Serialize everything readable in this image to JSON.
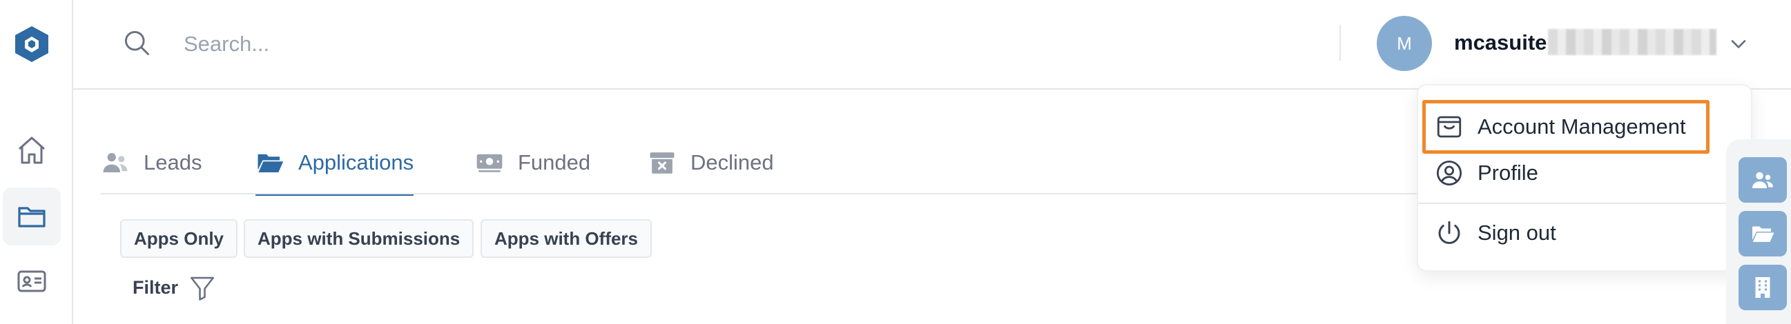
{
  "rail": {
    "items": [
      {
        "name": "home-icon"
      },
      {
        "name": "folder-icon",
        "active": true
      },
      {
        "name": "id-card-icon"
      }
    ]
  },
  "header": {
    "search_placeholder": "Search...",
    "avatar_initial": "M",
    "user_name": "mcasuite"
  },
  "tabs": [
    {
      "label": "Leads",
      "icon": "users-icon",
      "active": false
    },
    {
      "label": "Applications",
      "icon": "folder-open-icon",
      "active": true
    },
    {
      "label": "Funded",
      "icon": "money-icon",
      "active": false
    },
    {
      "label": "Declined",
      "icon": "archive-x-icon",
      "active": false
    }
  ],
  "chips": [
    "Apps Only",
    "Apps with Submissions",
    "Apps with Offers"
  ],
  "filter_label": "Filter",
  "menu": {
    "items": [
      {
        "label": "Account Management",
        "icon": "window-icon"
      },
      {
        "label": "Profile",
        "icon": "user-circle-icon"
      },
      {
        "label": "Sign out",
        "icon": "power-icon"
      }
    ]
  },
  "colors": {
    "accent": "#2e6aa3",
    "avatar": "#86acd1",
    "highlight": "#f0882b"
  }
}
